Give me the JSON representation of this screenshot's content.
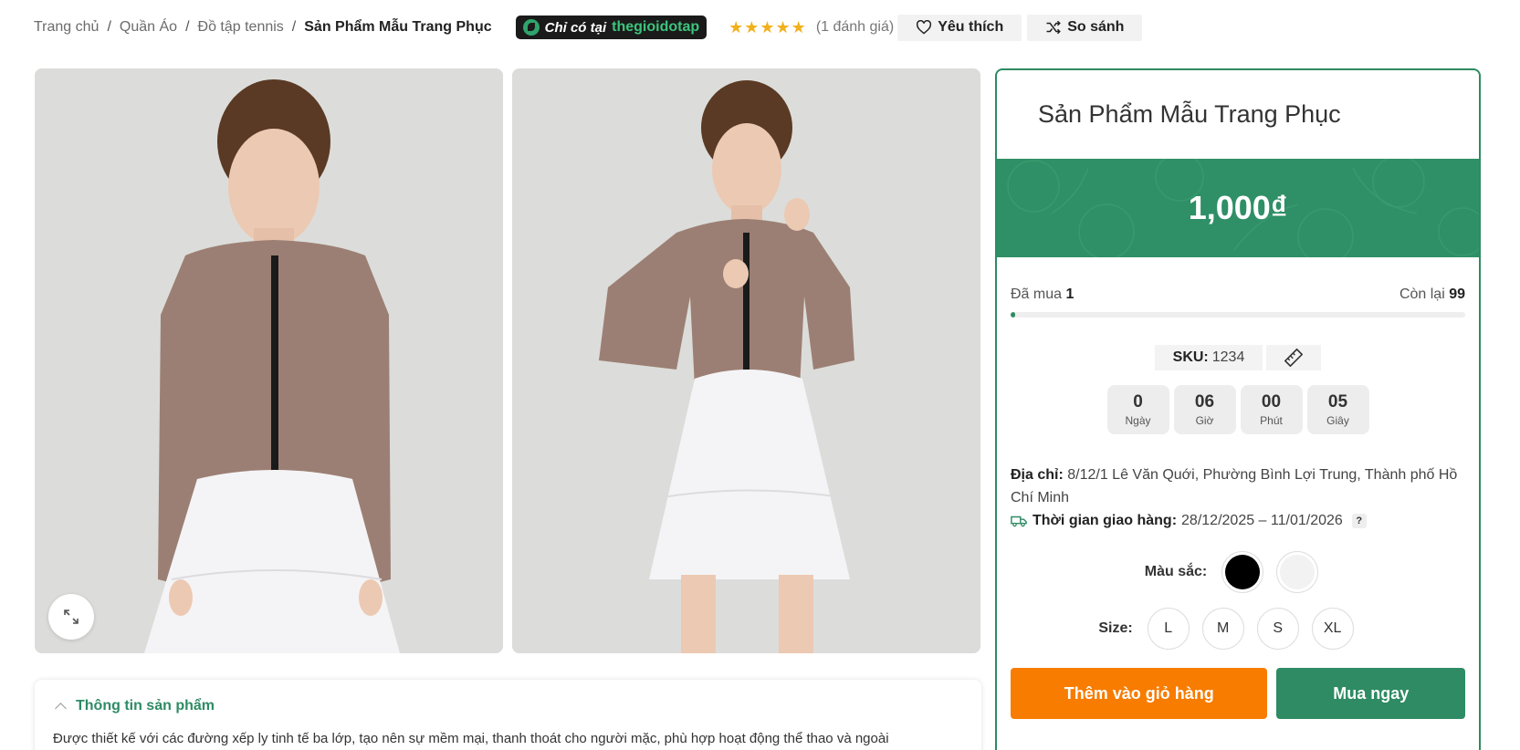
{
  "breadcrumb": {
    "items": [
      "Trang chủ",
      "Quần Áo",
      "Đồ tập tennis"
    ],
    "separator": "/",
    "current": "Sản Phẩm Mẫu Trang Phục"
  },
  "promo": {
    "prefix": "Chỉ có tại",
    "brand": "thegioidotap"
  },
  "rating": {
    "stars": "★★★★★",
    "stars_value": 5,
    "count_text": "(1 đánh giá)"
  },
  "actions_top": {
    "wishlist_label": "Yêu thích",
    "compare_label": "So sánh"
  },
  "product": {
    "title": "Sản Phẩm Mẫu Trang Phục",
    "price": "1,000₫",
    "sold_label": "Đã mua",
    "sold_value": "1",
    "remaining_label": "Còn lại",
    "remaining_value": "99",
    "sold_progress": 0.01,
    "sku_label": "SKU:",
    "sku_value": "1234"
  },
  "countdown": [
    {
      "value": "0",
      "label": "Ngày"
    },
    {
      "value": "06",
      "label": "Giờ"
    },
    {
      "value": "00",
      "label": "Phút"
    },
    {
      "value": "05",
      "label": "Giây"
    }
  ],
  "address": {
    "label": "Địa chỉ:",
    "value": "8/12/1 Lê Văn Quới, Phường Bình Lợi Trung, Thành phố Hồ Chí Minh"
  },
  "shipping": {
    "label": "Thời gian giao hàng:",
    "value": "28/12/2025 – 11/01/2026",
    "help": "?"
  },
  "color": {
    "label": "Màu sắc:",
    "options": [
      "#000000",
      "#f2f2f2"
    ]
  },
  "size": {
    "label": "Size:",
    "options": [
      "L",
      "M",
      "S",
      "XL"
    ]
  },
  "buttons": {
    "add_to_cart": "Thêm vào giỏ hàng",
    "buy_now": "Mua ngay"
  },
  "info": {
    "heading": "Thông tin sản phẩm",
    "text": "Được thiết kế với các đường xếp ly tinh tế ba lớp, tạo nên sự mềm mại, thanh thoát cho người mặc, phù hợp hoạt động thể thao và ngoài"
  },
  "colors": {
    "accent": "#2e8b63",
    "cart": "#f77c00",
    "star": "#f2b01e"
  }
}
